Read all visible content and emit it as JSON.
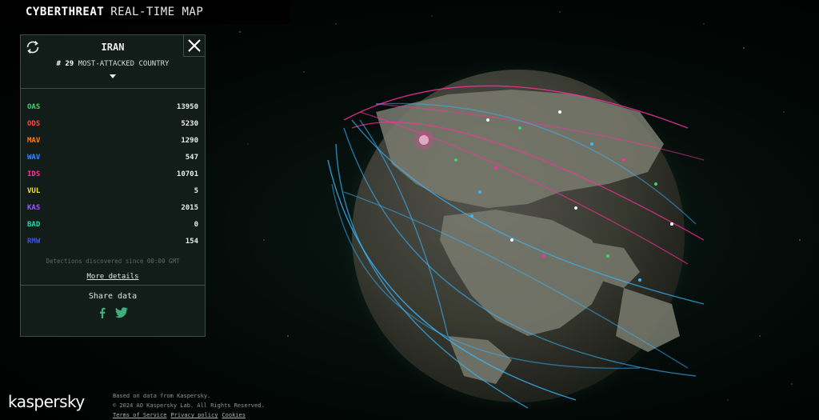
{
  "header": {
    "title_bold": "CYBERTHREAT",
    "title_rest": "REAL-TIME MAP"
  },
  "panel": {
    "country": "IRAN",
    "rank_prefix": "#",
    "rank_number": "29",
    "rank_label": "MOST-ATTACKED COUNTRY",
    "stats": [
      {
        "label": "OAS",
        "value": "13950",
        "color": "#3fd46b"
      },
      {
        "label": "ODS",
        "value": "5230",
        "color": "#ff4444"
      },
      {
        "label": "MAV",
        "value": "1290",
        "color": "#ff7a1a"
      },
      {
        "label": "WAV",
        "value": "547",
        "color": "#2f8cff"
      },
      {
        "label": "IDS",
        "value": "10701",
        "color": "#ff2fa0"
      },
      {
        "label": "VUL",
        "value": "5",
        "color": "#f2e32a"
      },
      {
        "label": "KAS",
        "value": "2015",
        "color": "#9b59ff"
      },
      {
        "label": "BAD",
        "value": "0",
        "color": "#22d6a8"
      },
      {
        "label": "RMW",
        "value": "154",
        "color": "#3a4dff"
      }
    ],
    "detections_note": "Detections discovered since 00:00 GMT",
    "more_details": "More details",
    "share_label": "Share data",
    "icons": {
      "rotate": "rotate-icon",
      "close": "close-icon",
      "facebook": "facebook-icon",
      "twitter": "twitter-icon"
    }
  },
  "footer": {
    "logo": "kaspersky",
    "line1": "Based on data from Kaspersky.",
    "line2": "© 2024 AO Kaspersky Lab. All Rights Reserved.",
    "links": [
      "Terms of Service",
      "Privacy policy",
      "Cookies"
    ]
  }
}
